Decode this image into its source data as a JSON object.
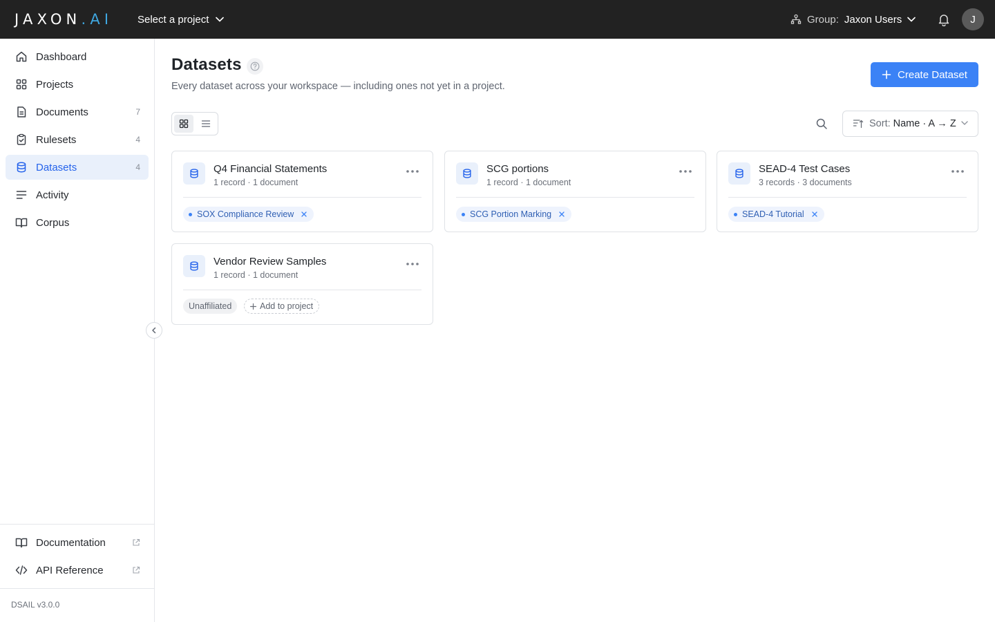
{
  "topbar": {
    "logo_main": "JAXON",
    "logo_ai": ".AI",
    "project_select": "Select a project",
    "group_label": "Group:",
    "group_name": "Jaxon Users",
    "avatar_initial": "J"
  },
  "sidebar": {
    "items": [
      {
        "label": "Dashboard",
        "count": "",
        "icon": "home-icon"
      },
      {
        "label": "Projects",
        "count": "",
        "icon": "grid-icon"
      },
      {
        "label": "Documents",
        "count": "7",
        "icon": "document-icon"
      },
      {
        "label": "Rulesets",
        "count": "4",
        "icon": "clipboard-check-icon"
      },
      {
        "label": "Datasets",
        "count": "4",
        "icon": "database-icon"
      },
      {
        "label": "Activity",
        "count": "",
        "icon": "lines-icon"
      },
      {
        "label": "Corpus",
        "count": "",
        "icon": "book-icon"
      }
    ],
    "footer_links": [
      {
        "label": "Documentation",
        "icon": "book-icon"
      },
      {
        "label": "API Reference",
        "icon": "code-icon"
      }
    ],
    "version": "DSAIL v3.0.0"
  },
  "main": {
    "title": "Datasets",
    "subtitle": "Every dataset across your workspace — including ones not yet in a project.",
    "create_button": "Create Dataset",
    "sort_prefix": "Sort:",
    "sort_value": "Name · A → Z"
  },
  "datasets": [
    {
      "name": "Q4 Financial Statements",
      "meta": "1 record · 1 document",
      "project": "SOX Compliance Review"
    },
    {
      "name": "SCG portions",
      "meta": "1 record · 1 document",
      "project": "SCG Portion Marking"
    },
    {
      "name": "SEAD-4 Test Cases",
      "meta": "3 records · 3 documents",
      "project": "SEAD-4 Tutorial"
    },
    {
      "name": "Vendor Review Samples",
      "meta": "1 record · 1 document",
      "unaffiliated_label": "Unaffiliated",
      "add_to_project_label": "Add to project"
    }
  ],
  "colors": {
    "topbar": "#222222",
    "accent": "#3b82f6",
    "active_nav_bg": "#e9f0fb",
    "logo_ai": "#3fa7e0"
  }
}
